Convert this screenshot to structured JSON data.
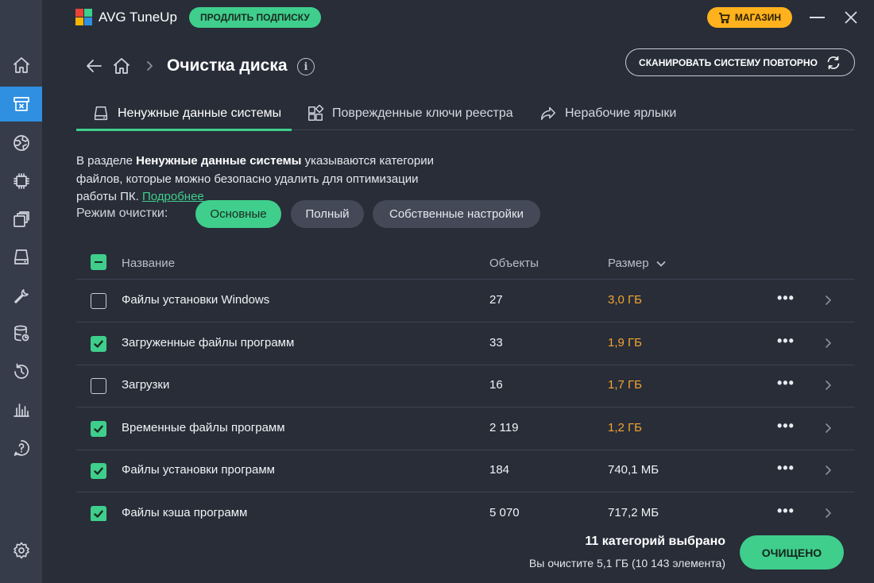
{
  "app": {
    "title": "AVG TuneUp",
    "renew_label": "ПРОДЛИТЬ ПОДПИСКУ",
    "shop_label": "МАГАЗИН",
    "colors": {
      "accent_green": "#3fce8c",
      "accent_orange": "#ffb21d",
      "active_nav": "#2f8fe0",
      "size_highlight": "#f3a431"
    }
  },
  "sidebar": {
    "items": [
      {
        "icon": "home-icon"
      },
      {
        "icon": "disk-cleanup-icon",
        "active": true
      },
      {
        "icon": "web-icon"
      },
      {
        "icon": "cpu-icon"
      },
      {
        "icon": "apps-icon"
      },
      {
        "icon": "drive-icon"
      },
      {
        "icon": "wrench-icon"
      },
      {
        "icon": "database-icon"
      },
      {
        "icon": "history-icon"
      },
      {
        "icon": "stats-icon"
      },
      {
        "icon": "help-icon"
      },
      {
        "icon": "settings-icon"
      }
    ]
  },
  "header": {
    "page_title": "Очистка диска",
    "rescan_label": "СКАНИРОВАТЬ СИСТЕМУ ПОВТОРНО"
  },
  "tabs": [
    {
      "label": "Ненужные данные системы",
      "icon": "drive-icon",
      "active": true
    },
    {
      "label": "Поврежденные ключи реестра",
      "icon": "grid-icon"
    },
    {
      "label": "Нерабочие ярлыки",
      "icon": "share-arrow-icon"
    }
  ],
  "description": {
    "before": "В разделе ",
    "bold": "Ненужные данные системы",
    "after": " указываются категории файлов, которые можно безопасно удалить для оптимизации работы ПК. ",
    "link": "Подробнее"
  },
  "modes": {
    "label": "Режим очистки:",
    "options": [
      "Основные",
      "Полный",
      "Собственные настройки"
    ],
    "selected": "Основные"
  },
  "table": {
    "headers": {
      "name": "Название",
      "objects": "Объекты",
      "size": "Размер"
    },
    "rows": [
      {
        "name": "Файлы установки Windows",
        "objects": "27",
        "size": "3,0 ГБ",
        "checked": false,
        "highlight": true
      },
      {
        "name": "Загруженные файлы программ",
        "objects": "33",
        "size": "1,9 ГБ",
        "checked": true,
        "highlight": true
      },
      {
        "name": "Загрузки",
        "objects": "16",
        "size": "1,7 ГБ",
        "checked": false,
        "highlight": true
      },
      {
        "name": "Временные файлы программ",
        "objects": "2 119",
        "size": "1,2 ГБ",
        "checked": true,
        "highlight": true
      },
      {
        "name": "Файлы установки программ",
        "objects": "184",
        "size": "740,1 МБ",
        "checked": true,
        "highlight": false
      },
      {
        "name": "Файлы кэша программ",
        "objects": "5 070",
        "size": "717,2 МБ",
        "checked": true,
        "highlight": false
      }
    ],
    "more_glyph": "•••"
  },
  "footer": {
    "summary_title": "11 категорий выбрано",
    "summary_sub": "Вы очистите 5,1 ГБ (10 143 элемента)",
    "clean_label": "ОЧИЩЕНО"
  }
}
